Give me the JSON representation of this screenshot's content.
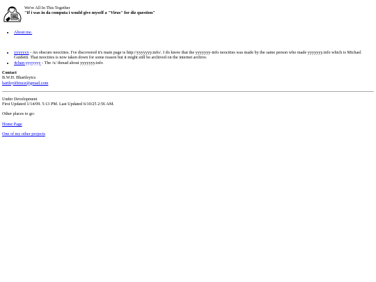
{
  "header": {
    "tagline": "We're All In This Together",
    "quote": "\"If i was in da computa i would give myself a \"Virus\" for diz question\""
  },
  "about": {
    "label": "About me."
  },
  "links": [
    {
      "link_text": "yyyyyyy",
      "desc": " - An obscure neocities. I've discovered it's main page is http://yyyyyyy.info/. I do know that the yyyyyyy-info neocities was made by the same person who made yyyyyyy.info which is Michael Guidetti. That neocities is now taken down for some reason but it might still be archived on the internet archive."
    },
    {
      "link_text": "4chan-yyyyyyy",
      "desc": " - The /x/ thread about yyyyyyy.info"
    }
  ],
  "contact": {
    "title": "Contact",
    "name": "B.W.H. Bhartleytcs",
    "email": "hartleyiibruce@gmail.com"
  },
  "status": {
    "state": "Under Development",
    "updated": "First Updated 1/14/09. 5:13 PM. Last Updated 6/10/25 2:56 AM."
  },
  "other_places": {
    "heading": "Other places to go:",
    "home_label": "Home Page",
    "projects_label": "One of my other projects"
  }
}
